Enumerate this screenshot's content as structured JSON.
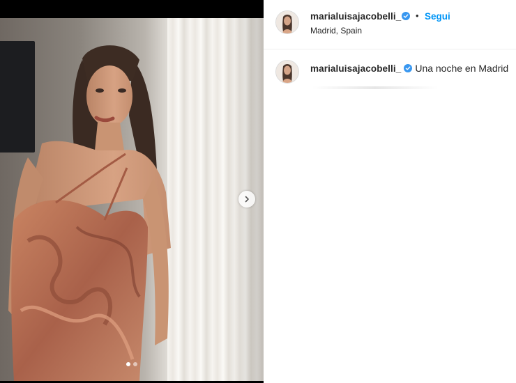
{
  "post": {
    "username": "marialuisajacobelli_",
    "separator": "•",
    "follow_label": "Segui",
    "location": "Madrid, Spain",
    "caption": "Una noche en Madrid",
    "carousel": {
      "slide_count": 2,
      "active_index": 0
    }
  },
  "icons": {
    "verified": "verified-badge-icon",
    "next": "chevron-right-icon"
  },
  "colors": {
    "accent": "#0095f6",
    "text": "#262626",
    "divider": "#efefef"
  }
}
